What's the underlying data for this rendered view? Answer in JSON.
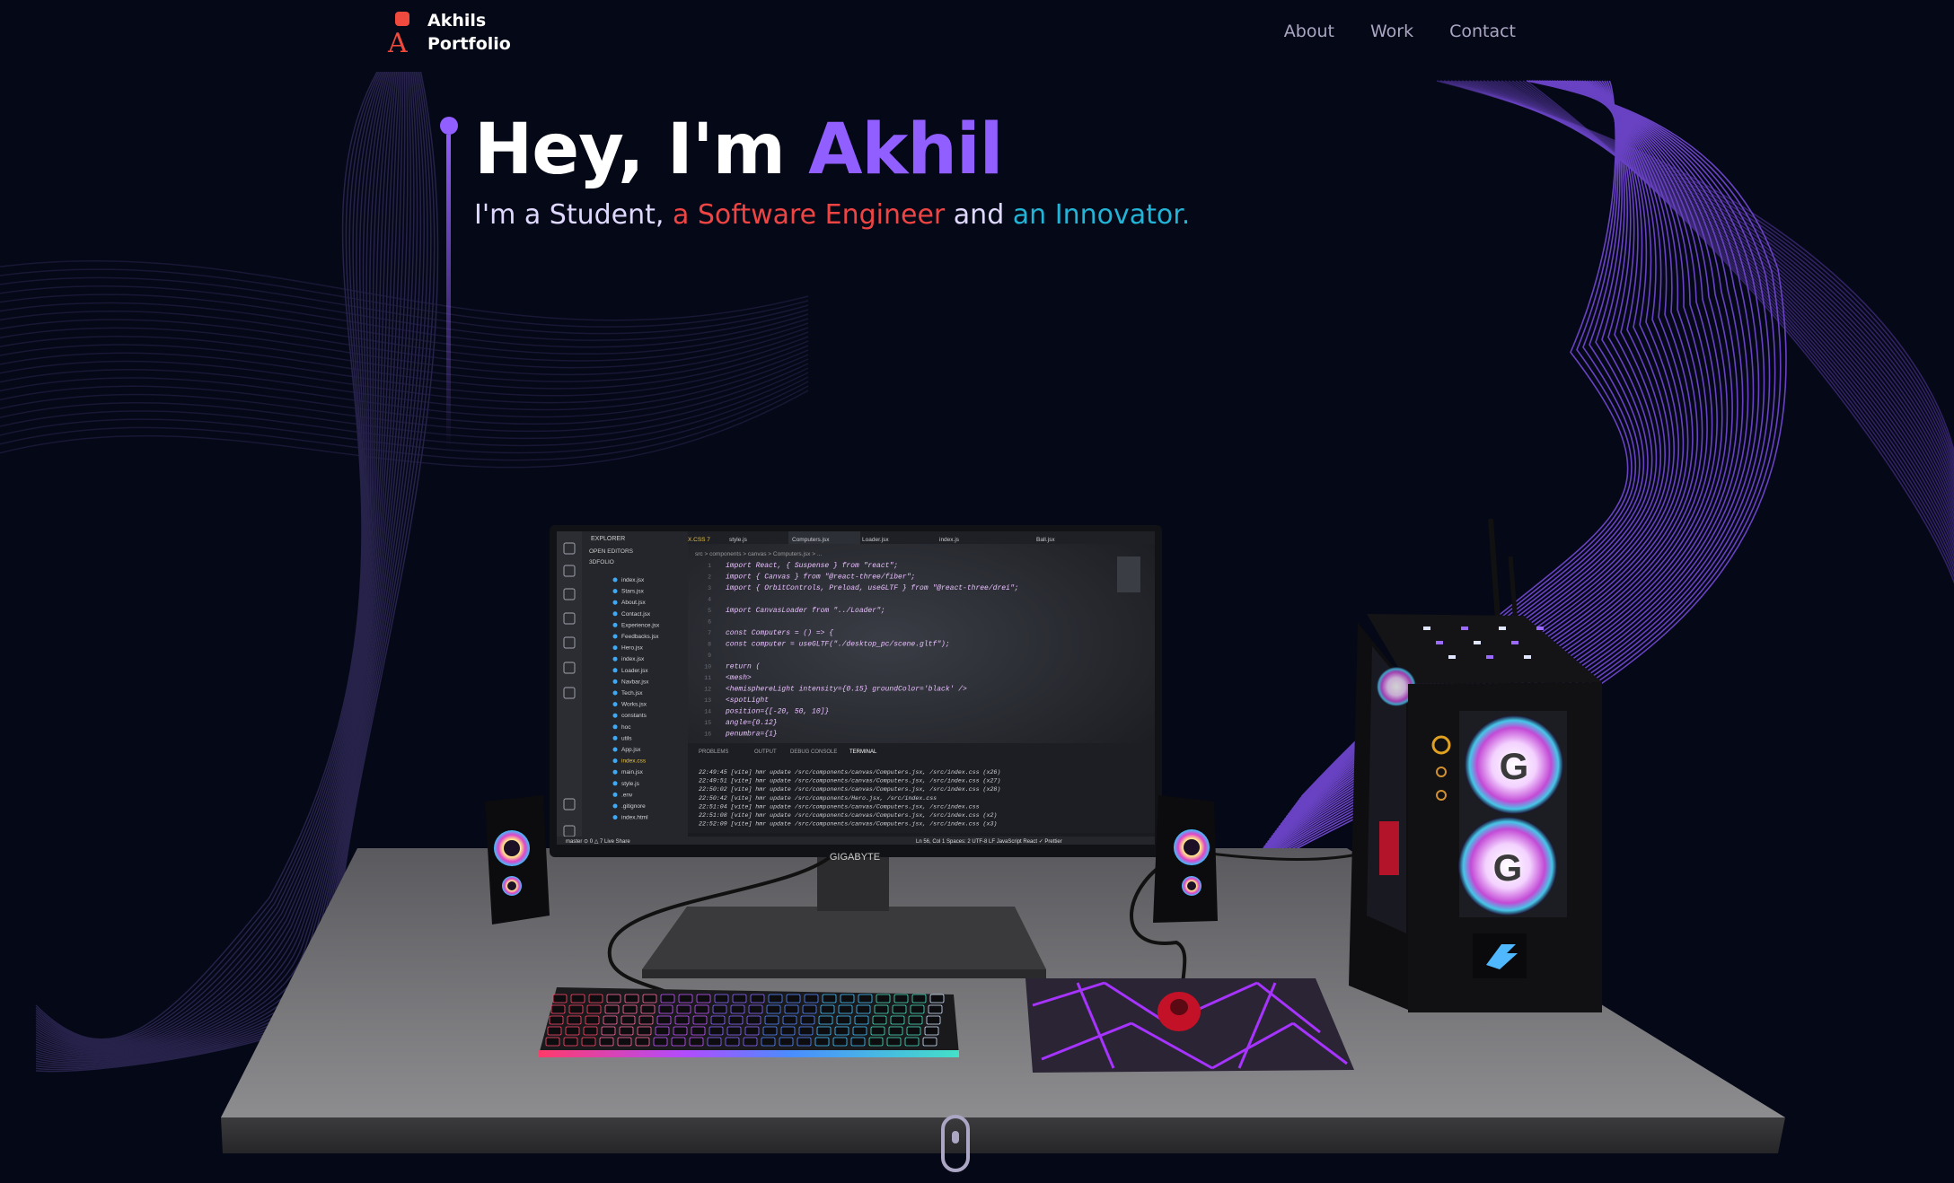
{
  "nav": {
    "logo_line1": "Akhils",
    "logo_line2": "Portfolio",
    "links": [
      "About",
      "Work",
      "Contact"
    ]
  },
  "hero": {
    "greeting": "Hey, I'm ",
    "name": "Akhil",
    "sub_part1": "I'm a Student, ",
    "sub_part2": "a Software Engineer",
    "sub_part3": " and ",
    "sub_part4": "an Innovator."
  },
  "monitor": {
    "brand": "GIGABYTE",
    "tabs": [
      "X.CSS 7",
      "style.js",
      "Computers.jsx",
      "Loader.jsx",
      "index.js",
      "Ball.jsx"
    ],
    "breadcrumb": "src > components > canvas > Computers.jsx > ...",
    "explorer_header": "EXPLORER",
    "open_editors": "OPEN EDITORS",
    "project": "3DFOLIO",
    "files": [
      "index.jsx",
      "Stars.jsx",
      "About.jsx",
      "Contact.jsx",
      "Experience.jsx",
      "Feedbacks.jsx",
      "Hero.jsx",
      "index.jsx",
      "Loader.jsx",
      "Navbar.jsx",
      "Tech.jsx",
      "Works.jsx",
      "constants",
      "hoc",
      "utils",
      "App.jsx",
      "index.css",
      "main.jsx",
      "style.js",
      ".env",
      ".gitignore",
      "index.html"
    ],
    "code": [
      "import React, { Suspense } from \"react\";",
      "import { Canvas } from \"@react-three/fiber\";",
      "import { OrbitControls, Preload, useGLTF } from \"@react-three/drei\";",
      "",
      "import CanvasLoader from \"../Loader\";",
      "",
      "const Computers = () => {",
      "  const computer = useGLTF(\"./desktop_pc/scene.gltf\");",
      "",
      "  return (",
      "    <mesh>",
      "      <hemisphereLight intensity={0.15} groundColor='black' />",
      "      <spotLight",
      "        position={[-20, 50, 10]}",
      "        angle={0.12}",
      "        penumbra={1}"
    ],
    "panel_tabs": [
      "PROBLEMS",
      "OUTPUT",
      "DEBUG CONSOLE",
      "TERMINAL"
    ],
    "terminal": [
      "22:49:45 [vite] hmr update /src/components/canvas/Computers.jsx, /src/index.css (x26)",
      "22:49:51 [vite] hmr update /src/components/canvas/Computers.jsx, /src/index.css (x27)",
      "22:50:02 [vite] hmr update /src/components/canvas/Computers.jsx, /src/index.css (x28)",
      "22:50:42 [vite] hmr update /src/components/Hero.jsx, /src/index.css",
      "22:51:04 [vite] hmr update /src/components/canvas/Computers.jsx, /src/index.css",
      "22:51:08 [vite] hmr update /src/components/canvas/Computers.jsx, /src/index.css (x2)",
      "22:52:09 [vite] hmr update /src/components/canvas/Computers.jsx, /src/index.css (x3)"
    ],
    "status_left": "master  ⊙ 0 △ 7   Live Share",
    "status_right": "Ln 56, Col 1   Spaces: 2   UTF-8   LF   JavaScript React   ✓ Prettier"
  },
  "icons": [
    "scroll-mouse-icon",
    "logo-icon"
  ],
  "colors": {
    "background": "#050816",
    "accent_purple": "#915eff",
    "accent_red": "#ef4444",
    "accent_cyan": "#22b3d6",
    "logo_orange": "#ef4a3d",
    "nav_text": "#aaa6c3"
  }
}
